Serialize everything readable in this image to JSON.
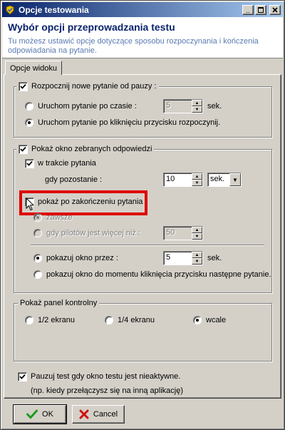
{
  "window": {
    "title": "Opcje testowania"
  },
  "header": {
    "title": "Wybór opcji przeprowadzania testu",
    "description": "Tu możesz ustawić opcje dotyczące sposobu rozpoczynania i kończenia odpowiadania na pytanie."
  },
  "tabs": [
    {
      "label": "Opcje widoku"
    }
  ],
  "group_pause": {
    "label": "Rozpocznij nowe pytanie od pauzy :",
    "checked": true,
    "radio_time_label": "Uruchom pytanie po czasie :",
    "radio_time_value": "5",
    "radio_time_unit": "sek.",
    "radio_click_label": "Uruchom pytanie po kliknięciu przycisku rozpoczynij."
  },
  "group_answers": {
    "label": "Pokaż okno zebranych odpowiedzi",
    "checked": true,
    "during_label": "w trakcie pytania",
    "remaining_label": "gdy pozostanie :",
    "remaining_value": "10",
    "remaining_unit": "sek.",
    "after_label": "pokaż po zakończeniu pytania",
    "always_label": "zawsze",
    "pilots_label": "gdy pilotów jest więcej niż :",
    "pilots_value": "50",
    "show_for_label": "pokazuj okno przez :",
    "show_for_value": "5",
    "show_for_unit": "sek.",
    "show_until_label": "pokazuj okno do momentu kliknięcia przycisku następne pytanie."
  },
  "group_panel": {
    "label": "Pokaż panel kontrolny",
    "options": [
      "1/2 ekranu",
      "1/4 ekranu",
      "wcale"
    ],
    "selected": "wcale"
  },
  "pause_inactive": {
    "label": "Pauzuj test gdy okno testu jest nieaktywne.",
    "hint": "(np. kiedy przełączysz się na inną aplikację)",
    "checked": true
  },
  "buttons": {
    "ok": "OK",
    "cancel": "Cancel"
  },
  "colors": {
    "title_bar": "#0a246a",
    "highlight": "#e00000",
    "header_title": "#0a246a"
  }
}
